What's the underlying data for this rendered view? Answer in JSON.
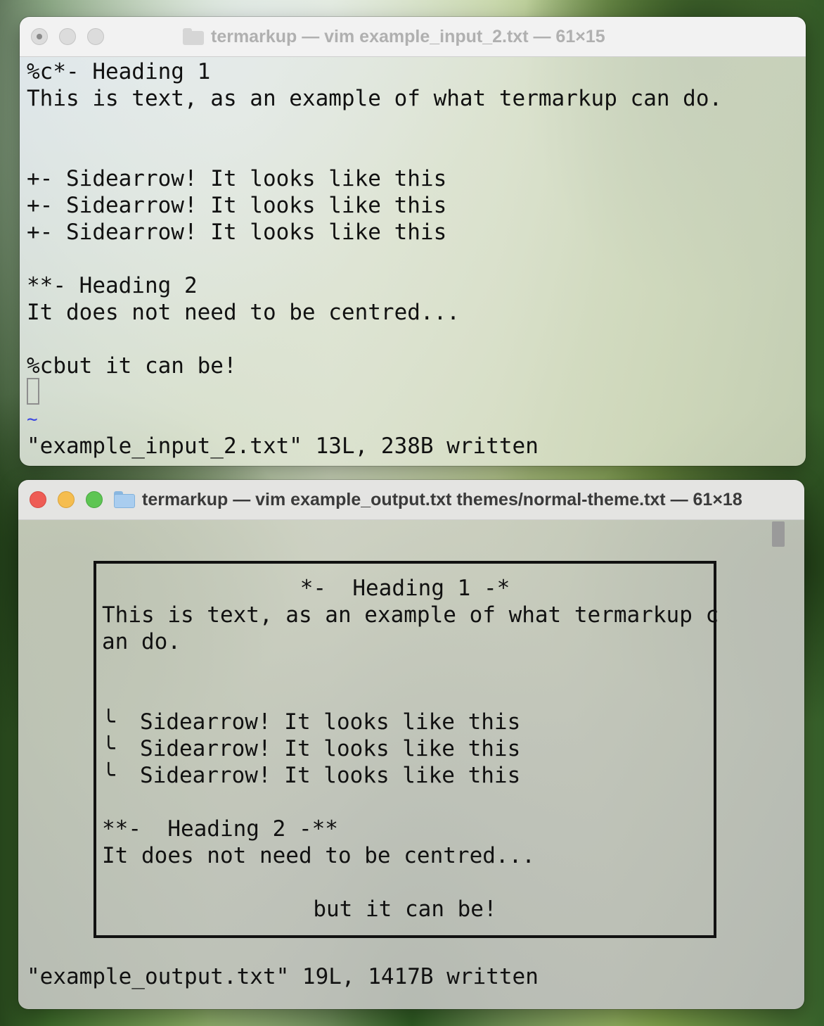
{
  "window_top": {
    "title": "termarkup — vim example_input_2.txt — 61×15",
    "lines": [
      "%c*- Heading 1",
      "This is text, as an example of what termarkup can do.",
      "",
      "",
      "+- Sidearrow! It looks like this",
      "+- Sidearrow! It looks like this",
      "+- Sidearrow! It looks like this",
      "",
      "**- Heading 2",
      "It does not need to be centred...",
      "",
      "%cbut it can be!"
    ],
    "tilde": "~",
    "status": "\"example_input_2.txt\" 13L, 238B written"
  },
  "window_bottom": {
    "title": "termarkup — vim example_output.txt themes/normal-theme.txt — 61×18",
    "box": {
      "heading1": "*-  Heading 1 -*",
      "text_line_1": "This is text, as an example of what termarkup c",
      "text_line_2": "an do.",
      "sidearrow_glyph": "╰",
      "sidearrows": [
        "Sidearrow! It looks like this",
        "Sidearrow! It looks like this",
        "Sidearrow! It looks like this"
      ],
      "heading2": "**-  Heading 2 -**",
      "heading2_text": "It does not need to be centred...",
      "centered_text": "but it can be!"
    },
    "status": "\"example_output.txt\" 19L, 1417B written"
  }
}
